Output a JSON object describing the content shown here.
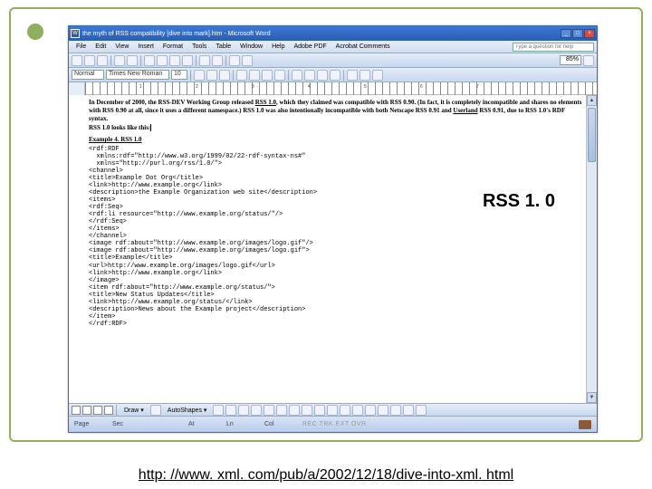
{
  "slide": {
    "callout_label": "RSS 1. 0",
    "footer_url": "http: //www. xml. com/pub/a/2002/12/18/dive-into-xml. html"
  },
  "titlebar": {
    "icon_glyph": "W",
    "title": "the myth of RSS compatibility [dive into mark].htm - Microsoft Word",
    "min": "_",
    "max": "□",
    "close": "×"
  },
  "menu": {
    "items": [
      "File",
      "Edit",
      "View",
      "Insert",
      "Format",
      "Tools",
      "Table",
      "Window",
      "Help",
      "Adobe PDF",
      "Acrobat Comments"
    ],
    "ask_placeholder": "Type a question for help"
  },
  "toolbar1": {
    "zoom": "85%"
  },
  "toolbar2": {
    "style": "Normal",
    "font": "Times New Roman",
    "size": "10"
  },
  "ruler": {
    "marks": [
      "1",
      "2",
      "3",
      "4",
      "5",
      "6",
      "7"
    ]
  },
  "document": {
    "p1_a": "In December of 2000, the RSS-DEV Working Group released ",
    "p1_link1": "RSS 1.0",
    "p1_b": ", which they claimed was compatible with RSS 0.90. (In fact, it is completely incompatible and shares no elements with RSS 0.90 at all, since it uses a different namespace.) RSS 1.0 was also intentionally incompatible with both Netscape RSS 0.91 and ",
    "p1_link2": "Userland",
    "p1_c": " RSS 0.91, due to RSS 1.0's RDF syntax.",
    "p2": "RSS 1.0 looks like this:",
    "p3": "Example 4. RSS 1.0",
    "code_lines": [
      "<rdf:RDF",
      "  xmlns:rdf=\"http://www.w3.org/1999/02/22-rdf-syntax-ns#\"",
      "  xmlns=\"http://purl.org/rss/1.0/\">",
      "<channel>",
      "<title>Example Dot Org</title>",
      "<link>http://www.example.org</link>",
      "<description>the Example Organization web site</description>",
      "<items>",
      "<rdf:Seq>",
      "<rdf:li resource=\"http://www.example.org/status/\"/>",
      "</rdf:Seq>",
      "</items>",
      "</channel>",
      "<image rdf:about=\"http://www.example.org/images/logo.gif\"/>",
      "<image rdf:about=\"http://www.example.org/images/logo.gif\">",
      "<title>Example</title>",
      "<url>http://www.example.org/images/logo.gif</url>",
      "<link>http://www.example.org</link>",
      "</image>",
      "<item rdf:about=\"http://www.example.org/status/\">",
      "<title>New Status Updates</title>",
      "<link>http://www.example.org/status/</link>",
      "<description>News about the Example project</description>",
      "</item>",
      "</rdf:RDF>"
    ]
  },
  "drawbar": {
    "draw": "Draw ▾",
    "autoshapes": "AutoShapes ▾"
  },
  "status": {
    "page": "Page",
    "sec": "Sec",
    "at": "At",
    "ln": "Ln",
    "col": "Col",
    "indicators": "REC TRK EXT OVR"
  }
}
